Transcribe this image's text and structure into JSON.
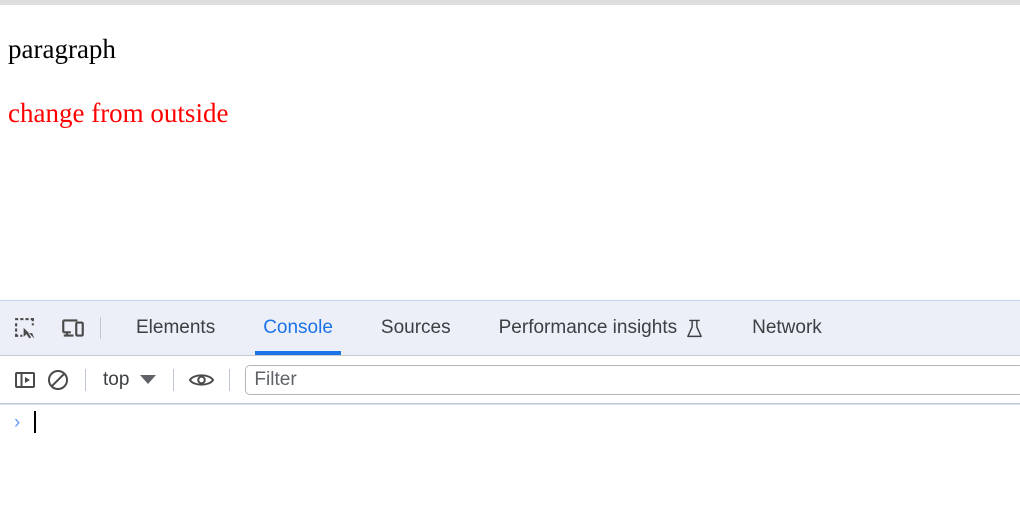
{
  "page": {
    "paragraph_text": "paragraph",
    "red_text": "change from outside",
    "red_color": "#ff0000"
  },
  "devtools": {
    "accent_color": "#1a73e8",
    "tabbar_background": "#eceff7",
    "toolbar_icons": [
      {
        "name": "inspect-element-icon",
        "title": "Inspect element"
      },
      {
        "name": "device-toolbar-icon",
        "title": "Toggle device toolbar"
      }
    ],
    "tabs": [
      {
        "label": "Elements",
        "active": false,
        "icon": null
      },
      {
        "label": "Console",
        "active": true,
        "icon": null
      },
      {
        "label": "Sources",
        "active": false,
        "icon": null
      },
      {
        "label": "Performance insights",
        "active": false,
        "icon": "flask-icon"
      },
      {
        "label": "Network",
        "active": false,
        "icon": null
      }
    ],
    "console_toolbar": {
      "sidebar_toggle_icon": "console-sidebar-toggle-icon",
      "clear_console_icon": "clear-console-icon",
      "context_value": "top",
      "live_expression_icon": "eye-icon",
      "filter_placeholder": "Filter",
      "filter_value": ""
    },
    "console_prompt": {
      "chevron": "›",
      "input_value": ""
    }
  }
}
